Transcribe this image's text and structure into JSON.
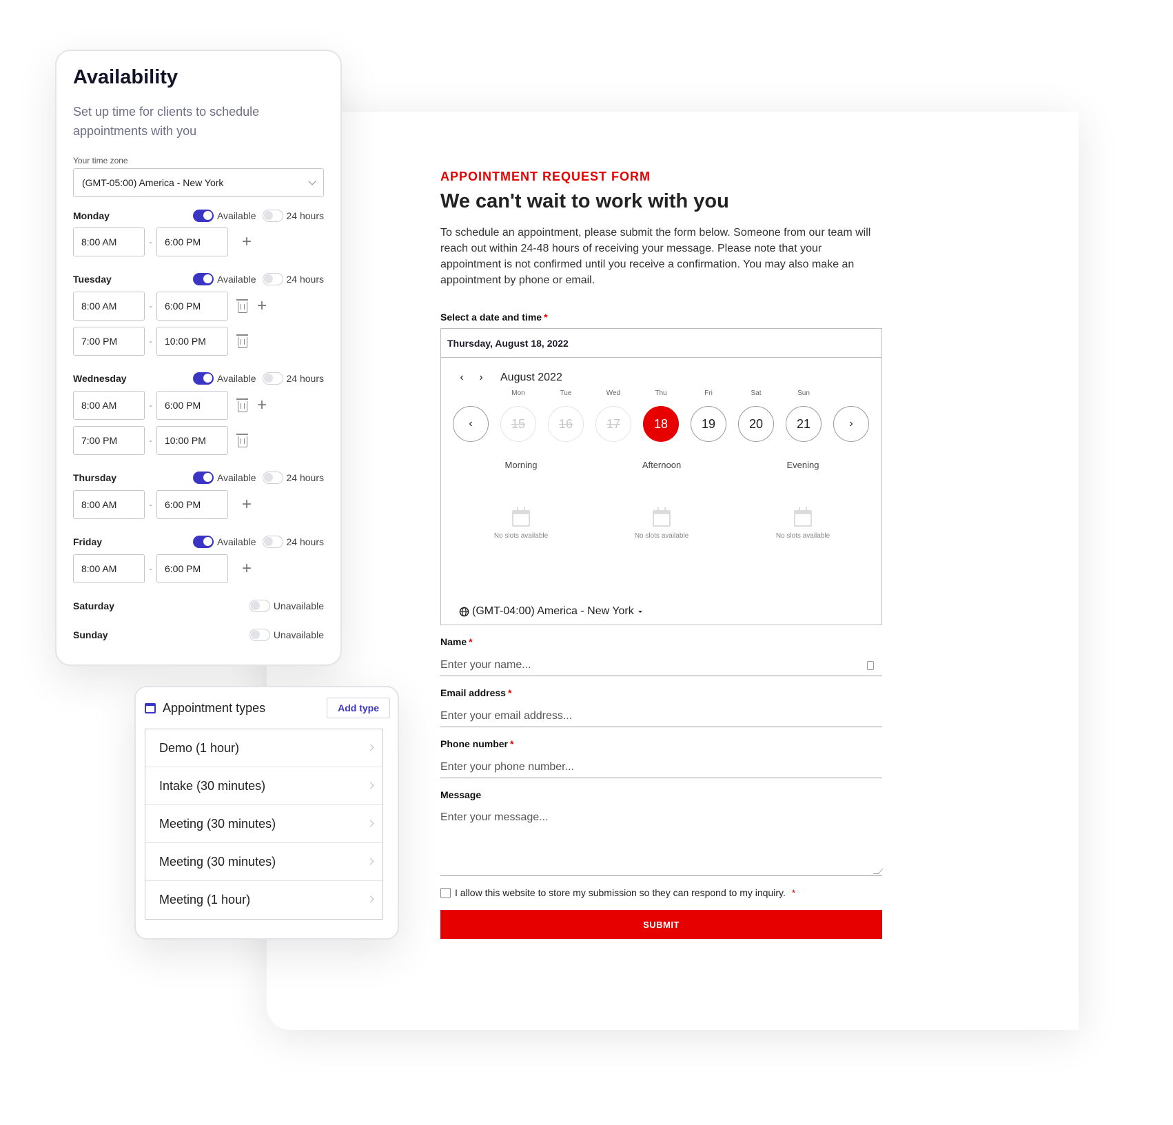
{
  "form": {
    "eyebrow": "APPOINTMENT REQUEST FORM",
    "headline": "We can't wait to work with you",
    "intro": "To schedule an appointment, please submit the form below. Someone from our team will reach out within 24-48 hours of receiving your message. Please note that your appointment is not confirmed until you receive a confirmation. You may also make an appointment by phone or email.",
    "datetime_label": "Select a date and time",
    "required_mark": "*",
    "selected_date": "Thursday, August 18, 2022",
    "month": "August 2022",
    "prev_month_icon": "‹",
    "next_month_icon": "›",
    "prev_week_icon": "‹",
    "next_week_icon": "›",
    "days": [
      {
        "name": "Mon",
        "num": "15",
        "state": "off"
      },
      {
        "name": "Tue",
        "num": "16",
        "state": "off"
      },
      {
        "name": "Wed",
        "num": "17",
        "state": "off"
      },
      {
        "name": "Thu",
        "num": "18",
        "state": "selected"
      },
      {
        "name": "Fri",
        "num": "19",
        "state": "on"
      },
      {
        "name": "Sat",
        "num": "20",
        "state": "on"
      },
      {
        "name": "Sun",
        "num": "21",
        "state": "on"
      }
    ],
    "periods": [
      "Morning",
      "Afternoon",
      "Evening"
    ],
    "no_slots": "No slots available",
    "timezone": "(GMT-04:00) America - New York",
    "name_label": "Name",
    "name_placeholder": "Enter your name...",
    "email_label": "Email address",
    "email_placeholder": "Enter your email address...",
    "phone_label": "Phone number",
    "phone_placeholder": "Enter your phone number...",
    "message_label": "Message",
    "message_placeholder": "Enter your message...",
    "consent": "I allow this website to store my submission so they can respond to my inquiry.",
    "submit": "SUBMIT",
    "accent": "#e60000"
  },
  "availability": {
    "title": "Availability",
    "subtitle": "Set up time for clients to schedule appointments with you",
    "tz_label": "Your time zone",
    "tz_value": "(GMT-05:00) America - New York",
    "available_label": "Available",
    "hours_label": "24 hours",
    "unavailable_label": "Unavailable",
    "accent": "#3b35c6",
    "days": {
      "monday": "Monday",
      "tuesday": "Tuesday",
      "wednesday": "Wednesday",
      "thursday": "Thursday",
      "friday": "Friday",
      "saturday": "Saturday",
      "sunday": "Sunday"
    },
    "times": {
      "start_1": "8:00 AM",
      "end_1": "6:00 PM",
      "start_2": "7:00 PM",
      "end_2": "10:00 PM"
    },
    "separator": "-",
    "add_icon": "+"
  },
  "types": {
    "title": "Appointment types",
    "add_button": "Add type",
    "items": [
      "Demo (1 hour)",
      "Intake (30 minutes)",
      "Meeting (30 minutes)",
      "Meeting (30 minutes)",
      "Meeting (1 hour)"
    ]
  }
}
